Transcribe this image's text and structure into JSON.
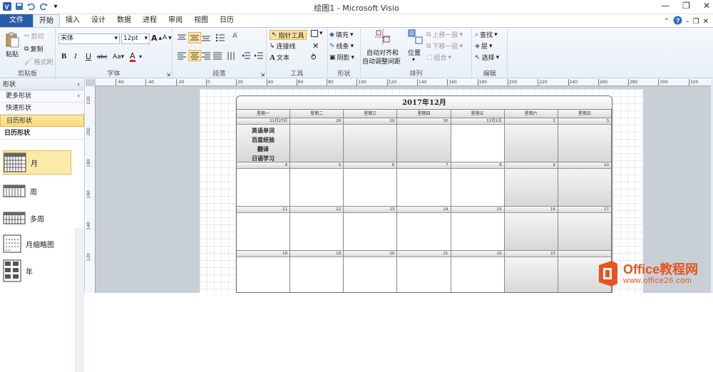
{
  "window": {
    "title": "绘图1 - Microsoft Visio",
    "controls": [
      "—",
      "❐",
      "✕"
    ]
  },
  "tabs": [
    "文件",
    "开始",
    "插入",
    "设计",
    "数据",
    "进程",
    "审阅",
    "视图",
    "日历"
  ],
  "ribbon": {
    "clipboard": {
      "label": "剪贴板",
      "paste": "粘贴",
      "cut": "剪切",
      "copy": "复制",
      "format_painter": "格式刷"
    },
    "font": {
      "label": "字体",
      "font_name": "宋体",
      "font_size": "12pt"
    },
    "paragraph": {
      "label": "段落"
    },
    "tools": {
      "label": "工具",
      "pointer": "指针工具",
      "connector": "连接线",
      "text": "文本"
    },
    "shape": {
      "label": "形状",
      "fill": "填充",
      "line": "线条",
      "shadow": "阴影"
    },
    "arrange": {
      "label": "排列",
      "auto_align": "自动对齐和",
      "auto_space": "自动调整间距",
      "position": "位置",
      "bring_forward": "上移一层",
      "send_backward": "下移一层",
      "group": "组合"
    },
    "editing": {
      "label": "编辑",
      "find": "查找",
      "layers": "层",
      "select": "选择"
    }
  },
  "shapes_pane": {
    "title": "形状",
    "rows": [
      "更多形状",
      "快速形状",
      "日历形状"
    ],
    "stencil_title": "日历形状",
    "items": [
      {
        "label": "月",
        "icon": "month-calendar-icon"
      },
      {
        "label": "周",
        "icon": "week-calendar-icon"
      },
      {
        "label": "多周",
        "icon": "multi-week-calendar-icon"
      },
      {
        "label": "月缩略图",
        "icon": "month-thumbnail-icon"
      },
      {
        "label": "年",
        "icon": "year-calendar-icon"
      }
    ]
  },
  "ruler": {
    "h_labels": [
      "-60",
      "-40",
      "-20",
      "0",
      "20",
      "40",
      "60",
      "80",
      "100",
      "120",
      "140",
      "160",
      "180",
      "200",
      "220",
      "240",
      "260",
      "280",
      "300",
      "320"
    ],
    "v_labels": [
      "220",
      "200",
      "180",
      "160",
      "140",
      "120"
    ]
  },
  "calendar": {
    "title": "2017年12月",
    "weekdays": [
      "星期一",
      "星期二",
      "星期三",
      "星期四",
      "星期五",
      "星期六",
      "星期日"
    ],
    "weeks": [
      [
        "11月27日",
        "28",
        "29",
        "30",
        "12月1日",
        "2",
        "3"
      ],
      [
        "4",
        "5",
        "6",
        "7",
        "8",
        "9",
        "10"
      ],
      [
        "11",
        "12",
        "13",
        "14",
        "15",
        "16",
        "17"
      ],
      [
        "18",
        "19",
        "20",
        "21",
        "22",
        "23",
        ""
      ]
    ],
    "note_lines": [
      "英语单词",
      "百度经验",
      "翻译",
      "日语学习"
    ]
  },
  "watermark": {
    "brand": "Office教程网",
    "url": "www.office26.com",
    "brand_color": "#e8531e"
  }
}
